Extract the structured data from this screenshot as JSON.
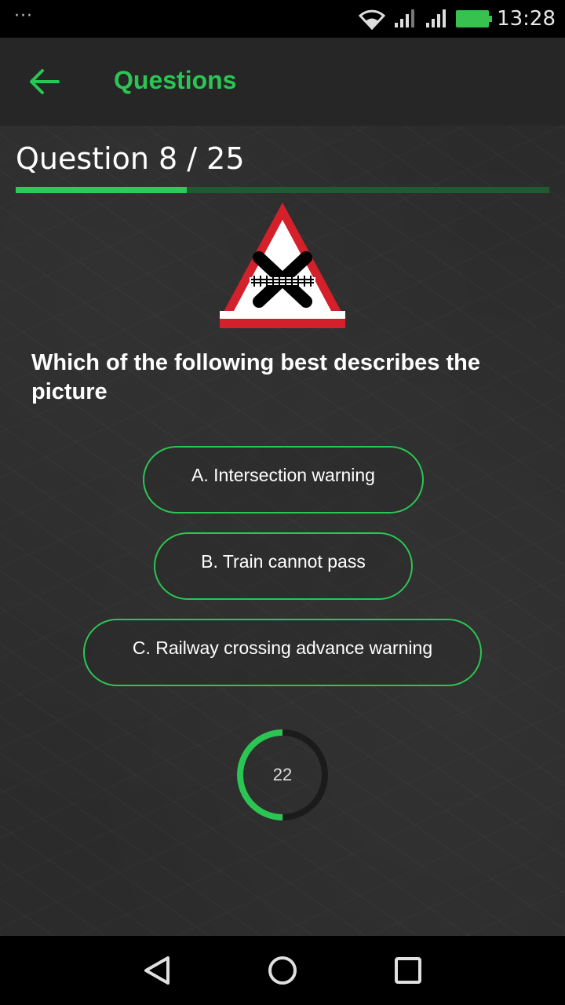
{
  "status_bar": {
    "time": "13:28",
    "overflow_icon": "more-dots-icon",
    "icons": [
      "wifi-icon",
      "signal-icon",
      "signal-icon",
      "battery-charging-icon"
    ]
  },
  "app_bar": {
    "back_icon": "arrow-left-icon",
    "title": "Questions"
  },
  "quiz": {
    "counter": "Question 8 / 25",
    "progress_fraction": 0.32,
    "question": "Which of the following best describes the picture",
    "options": [
      {
        "label": "A. Intersection warning"
      },
      {
        "label": "B. Train cannot pass"
      },
      {
        "label": "C. Railway crossing advance warning"
      }
    ],
    "timer": {
      "value": "22",
      "fraction_remaining": 0.5
    }
  },
  "colors": {
    "accent": "#2bc553",
    "track": "#1f5a33",
    "sign_border": "#d3202a"
  },
  "nav_bar": {
    "icons": [
      "back-triangle-icon",
      "home-circle-icon",
      "recents-square-icon"
    ]
  }
}
